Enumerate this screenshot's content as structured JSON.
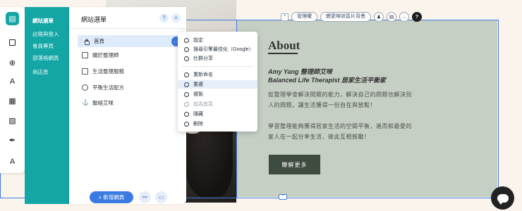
{
  "toolbar": {
    "manage_label": "管理權",
    "bg_label": "變更帶狀區片背景"
  },
  "teal_menu": {
    "items": [
      "網站選單",
      "註冊與登入",
      "會員專頁",
      "部落格網頁",
      "商店頁"
    ]
  },
  "site_menu": {
    "title": "網站選單",
    "help_icon": "?",
    "close_icon": "×",
    "pages": [
      {
        "label": "首頁",
        "selected": true
      },
      {
        "label": "關於整理師"
      },
      {
        "label": "生活整理服務"
      },
      {
        "label": "平衡生活配方"
      },
      {
        "label": "聯絡艾咪"
      }
    ],
    "add_page_label": "+ 新增網頁"
  },
  "context_menu": {
    "items": [
      {
        "label": "設定"
      },
      {
        "label": "搜尋引擎最佳化（Google）"
      },
      {
        "label": "社群分享"
      },
      {
        "label": "重新命名"
      },
      {
        "label": "重複",
        "highlighted": true
      },
      {
        "label": "複製"
      },
      {
        "label": "設為首頁",
        "disabled": true
      },
      {
        "label": "隱藏"
      },
      {
        "label": "刪除"
      }
    ]
  },
  "site": {
    "about_title": "About",
    "about_sub1": "Amy Yang 整理師艾咪",
    "about_sub2": "Balanced Life Therapist 居家生活平衡家",
    "about_p1": "從整理學會解決問題的能力，解決自己的問題也解決別人的問題，讓生活獲得一份自在與放鬆！",
    "about_p2": "學習整理能夠獲得居家生活的空間平衡，進而和最愛的家人在一起分享生活，彼此互相鼓勵！",
    "learn_more_label": "瞭解更多"
  },
  "colors": {
    "teal": "#14a5a5",
    "accent_blue": "#3b7be0",
    "sage": "#c5cfc3",
    "button_dark": "#3e4b3f"
  }
}
